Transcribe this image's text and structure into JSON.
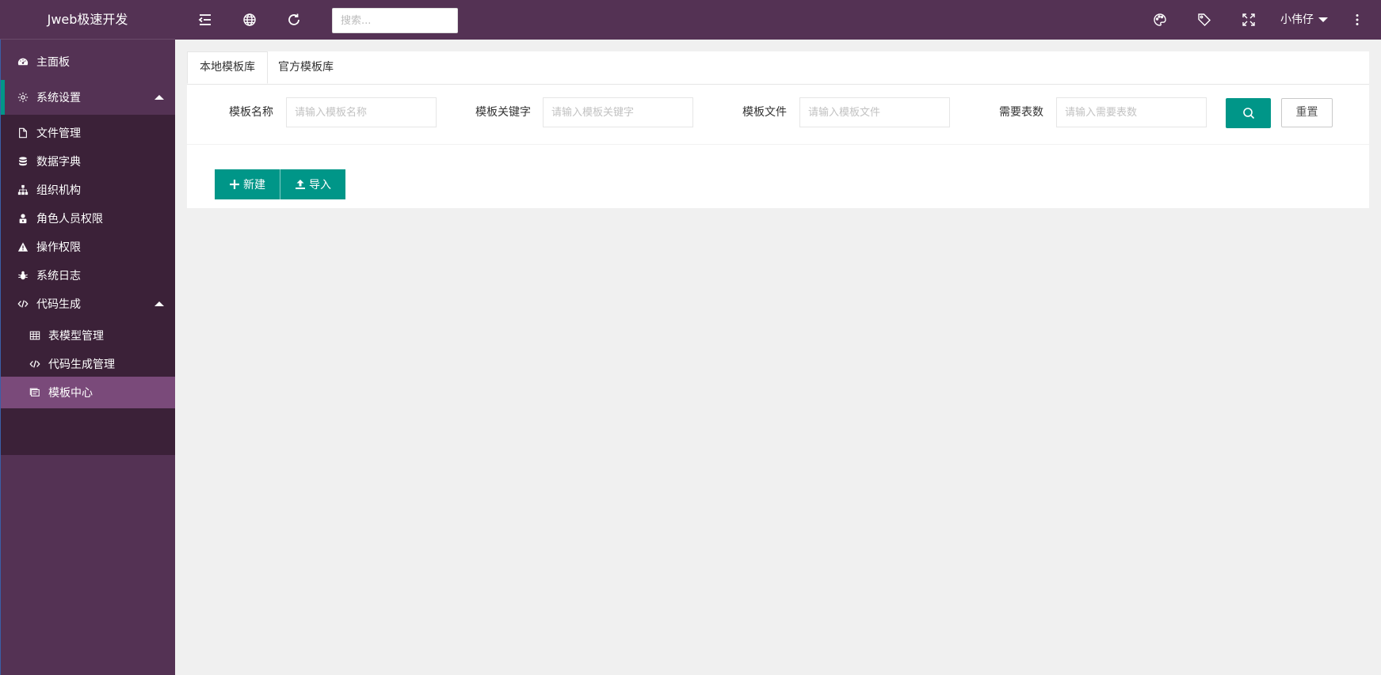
{
  "app": {
    "title": "Jweb极速开发"
  },
  "header": {
    "search_placeholder": "搜索...",
    "user_name": "小伟仔",
    "icons": [
      "menu-fold-icon",
      "globe-icon",
      "refresh-icon",
      "palette-icon",
      "tag-icon",
      "fullscreen-icon",
      "more-vertical-icon"
    ]
  },
  "sidebar": {
    "items": [
      {
        "label": "主面板",
        "icon": "dashboard-icon"
      },
      {
        "label": "系统设置",
        "icon": "gear-icon",
        "expanded": true
      },
      {
        "label": "文件管理",
        "icon": "file-icon"
      },
      {
        "label": "数据字典",
        "icon": "database-icon"
      },
      {
        "label": "组织机构",
        "icon": "sitemap-icon"
      },
      {
        "label": "角色人员权限",
        "icon": "user-lock-icon"
      },
      {
        "label": "操作权限",
        "icon": "warning-icon"
      },
      {
        "label": "系统日志",
        "icon": "bug-icon"
      },
      {
        "label": "代码生成",
        "icon": "code-icon",
        "expanded": true
      },
      {
        "label": "表模型管理",
        "icon": "table-icon"
      },
      {
        "label": "代码生成管理",
        "icon": "code-icon"
      },
      {
        "label": "模板中心",
        "icon": "template-icon",
        "selected": true
      }
    ]
  },
  "main": {
    "tabs": [
      {
        "label": "本地模板库",
        "active": true
      },
      {
        "label": "官方模板库",
        "active": false
      }
    ],
    "filters": [
      {
        "label": "模板名称",
        "placeholder": "请输入模板名称"
      },
      {
        "label": "模板关键字",
        "placeholder": "请输入模板关键字"
      },
      {
        "label": "模板文件",
        "placeholder": "请输入模板文件"
      },
      {
        "label": "需要表数",
        "placeholder": "请输入需要表数"
      }
    ],
    "reset_label": "重置",
    "actions": {
      "new_label": "新建",
      "import_label": "导入"
    }
  },
  "colors": {
    "primary": "#543254",
    "accent": "#009688",
    "submenu_bg": "#3b2138",
    "selected_bg": "#7a4a7a"
  }
}
